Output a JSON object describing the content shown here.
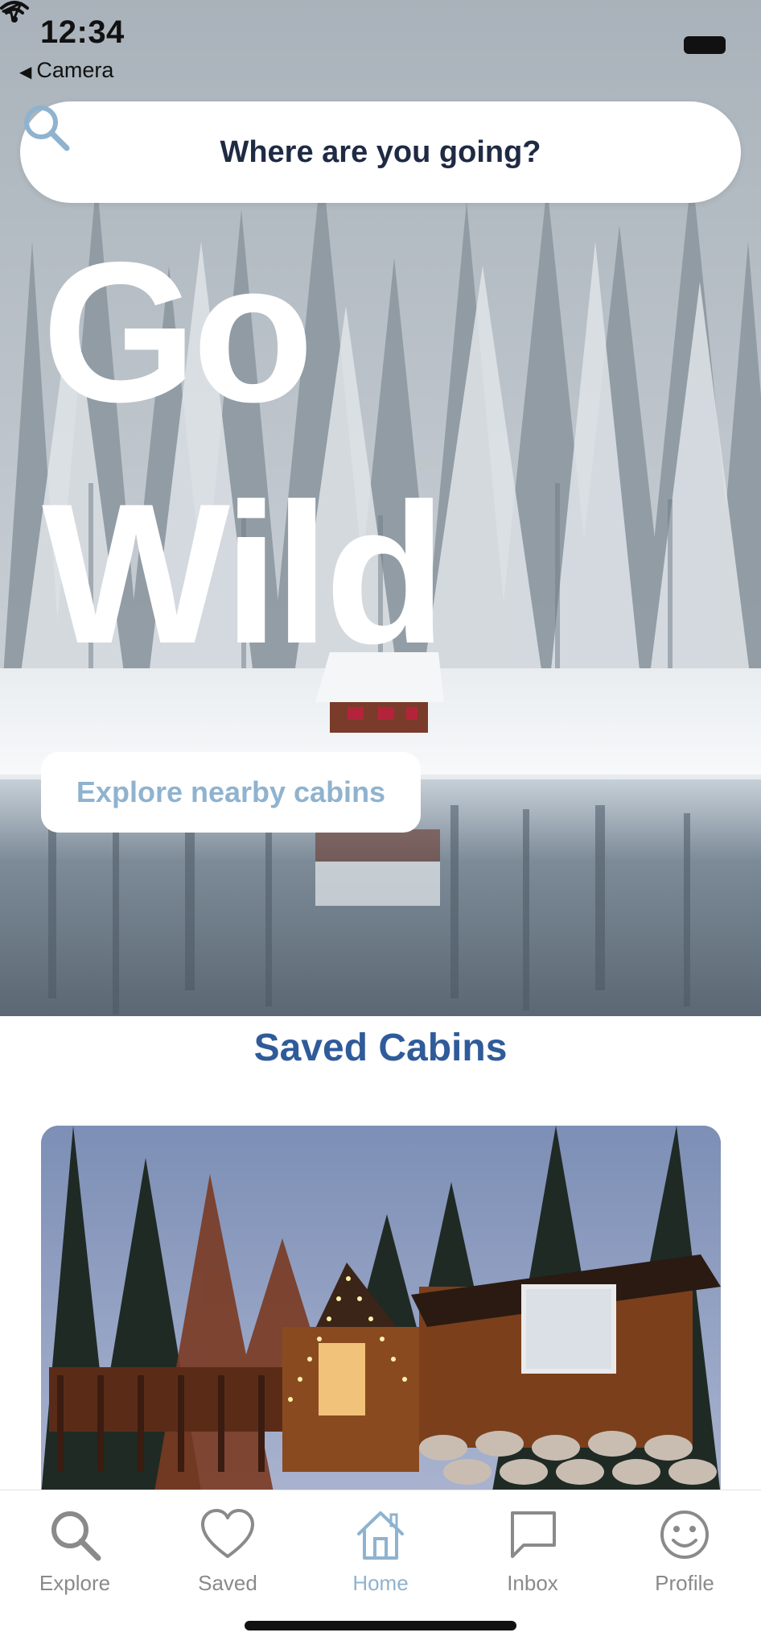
{
  "status_bar": {
    "time": "12:34",
    "back_label": "Camera"
  },
  "search": {
    "placeholder": "Where are you going?"
  },
  "hero": {
    "title_line1": "Go",
    "title_line2": "Wild",
    "explore_button": "Explore nearby cabins"
  },
  "saved": {
    "title": "Saved Cabins"
  },
  "tabbar": {
    "items": [
      {
        "label": "Explore",
        "icon": "search-icon"
      },
      {
        "label": "Saved",
        "icon": "heart-icon"
      },
      {
        "label": "Home",
        "icon": "home-icon"
      },
      {
        "label": "Inbox",
        "icon": "chat-icon"
      },
      {
        "label": "Profile",
        "icon": "smiley-icon"
      }
    ],
    "active": "Home"
  },
  "colors": {
    "accent": "#8fb3cf",
    "section_title": "#2f5b9a",
    "search_text": "#1f2a44",
    "tab_inactive": "#8a8a8a"
  }
}
